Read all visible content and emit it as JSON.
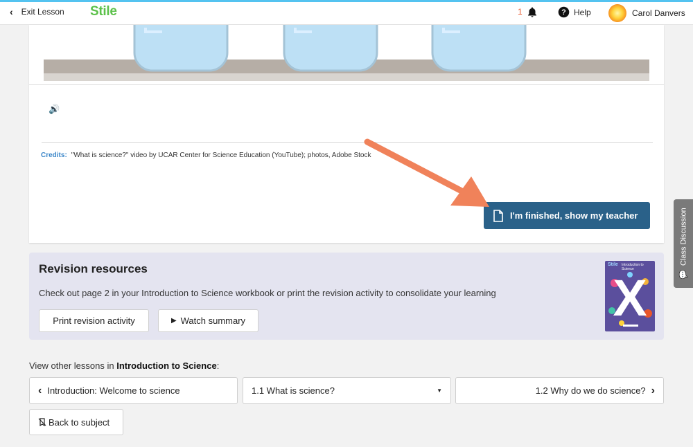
{
  "topbar": {
    "exit_label": "Exit Lesson",
    "logo": "Stile",
    "notification_count": "1",
    "help_label": "Help",
    "user_name": "Carol Danvers"
  },
  "lesson_card": {
    "credits_label": "Credits:",
    "credits_text": "\"What is science?\" video by UCAR Center for Science Education (YouTube); photos, Adobe Stock",
    "finish_button": "I'm finished, show my teacher"
  },
  "revision": {
    "title": "Revision resources",
    "description": "Check out page 2 in your Introduction to Science workbook or print the revision activity to consolidate your learning",
    "print_button": "Print revision activity",
    "watch_button": "Watch summary",
    "book_brand": "Stile",
    "book_title": "Introduction to Science",
    "book_letter": "X"
  },
  "lesson_nav": {
    "label_prefix": "View other lessons in ",
    "subject": "Introduction to Science",
    "label_suffix": ":",
    "previous": "Introduction: Welcome to science",
    "current": "1.1 What is science?",
    "next": "1.2 Why do we do science?",
    "back": "Back to subject"
  },
  "side_tab": {
    "label": "Class Discussion"
  },
  "colors": {
    "accent_top": "#54c3f0",
    "logo_green": "#5cc14a",
    "finish_button": "#2a6189",
    "arrow": "#f0825a",
    "revision_bg": "#e4e4f0"
  }
}
